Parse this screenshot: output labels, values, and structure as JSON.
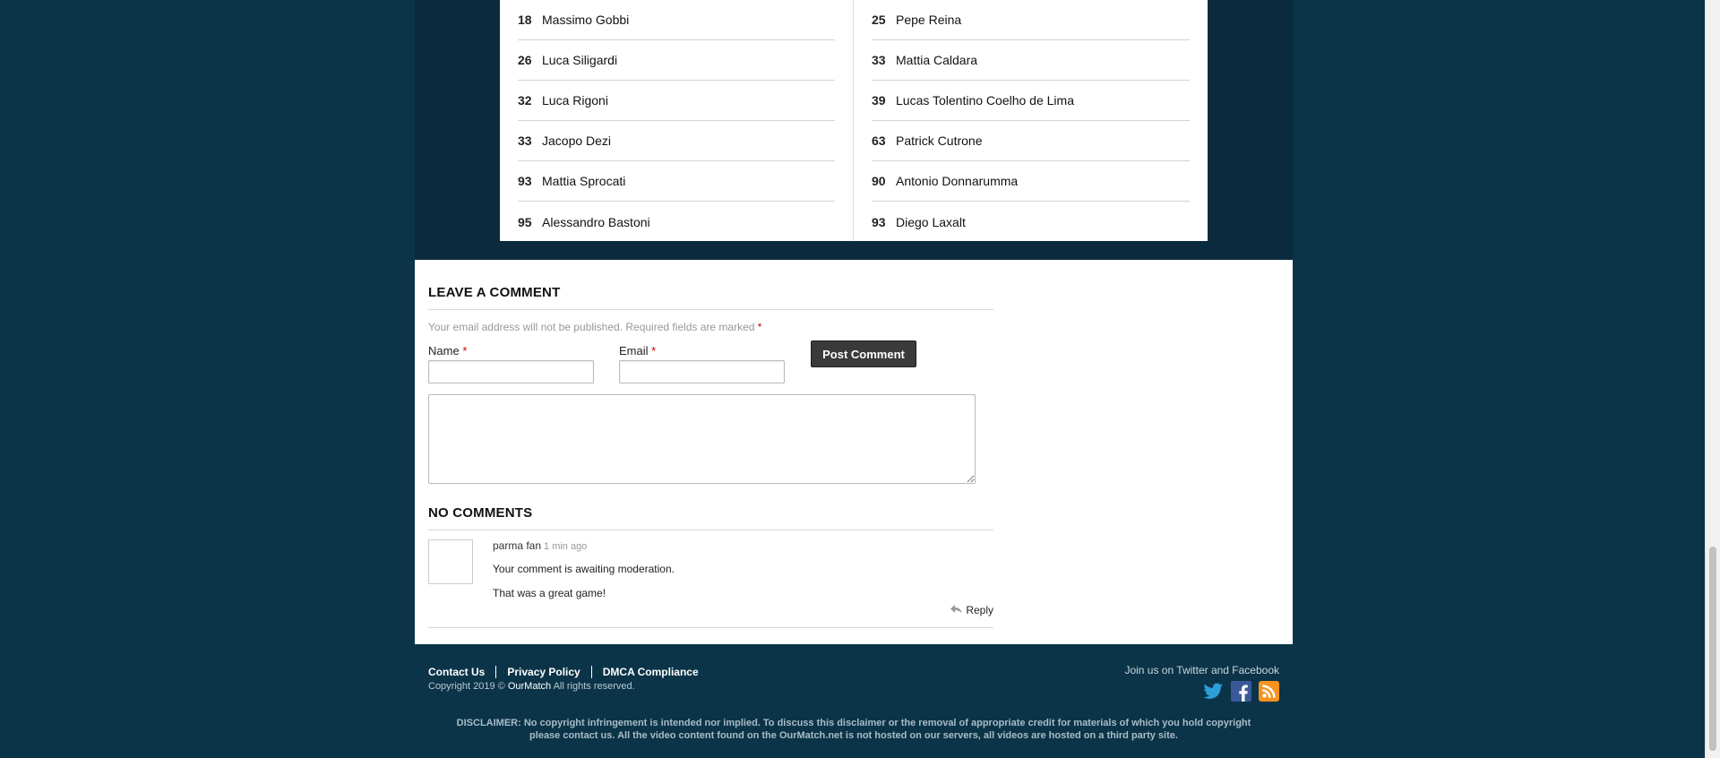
{
  "lineups": {
    "home": [
      {
        "number": "18",
        "name": "Massimo Gobbi"
      },
      {
        "number": "26",
        "name": "Luca Siligardi"
      },
      {
        "number": "32",
        "name": "Luca Rigoni"
      },
      {
        "number": "33",
        "name": "Jacopo Dezi"
      },
      {
        "number": "93",
        "name": "Mattia Sprocati"
      },
      {
        "number": "95",
        "name": "Alessandro Bastoni"
      }
    ],
    "away": [
      {
        "number": "25",
        "name": "Pepe Reina"
      },
      {
        "number": "33",
        "name": "Mattia Caldara"
      },
      {
        "number": "39",
        "name": "Lucas Tolentino Coelho de Lima"
      },
      {
        "number": "63",
        "name": "Patrick Cutrone"
      },
      {
        "number": "90",
        "name": "Antonio Donnarumma"
      },
      {
        "number": "93",
        "name": "Diego Laxalt"
      }
    ]
  },
  "comment_form": {
    "title": "LEAVE A COMMENT",
    "notes": "Your email address will not be published. Required fields are marked",
    "required_mark": "*",
    "name_label": "Name",
    "email_label": "Email",
    "name_value": "",
    "email_value": "",
    "comment_value": "",
    "submit_label": "Post Comment"
  },
  "comments": {
    "title": "NO COMMENTS",
    "items": [
      {
        "author": "parma fan",
        "time": "1 min ago",
        "status": "Your comment is awaiting moderation.",
        "text": "That was a great game!",
        "reply_label": "Reply"
      }
    ]
  },
  "footer": {
    "links": [
      "Contact Us",
      "Privacy Policy",
      "DMCA Compliance"
    ],
    "copyright_prefix": "Copyright 2019 ©",
    "brand": "OurMatch",
    "copyright_suffix": "All rights reserved.",
    "join_text": "Join us on Twitter and Facebook",
    "social_icons": [
      "twitter-icon",
      "facebook-icon",
      "rss-icon"
    ],
    "disclaimer_line1": "DISCLAIMER: No copyright infringement is intended nor implied. To discuss this disclaimer or the removal of appropriate credit for materials of which you hold copyright",
    "disclaimer_line2": "please contact us. All the video content found on the OurMatch.net is not hosted on our servers, all videos are hosted on a third party site."
  },
  "colors": {
    "background": "#0b3448",
    "panel": "#ffffff",
    "button": "#3a3a3a",
    "required": "#cc0000",
    "twitter": "#2a9fd8",
    "facebook": "#3b5998",
    "rss": "#f7931e"
  }
}
